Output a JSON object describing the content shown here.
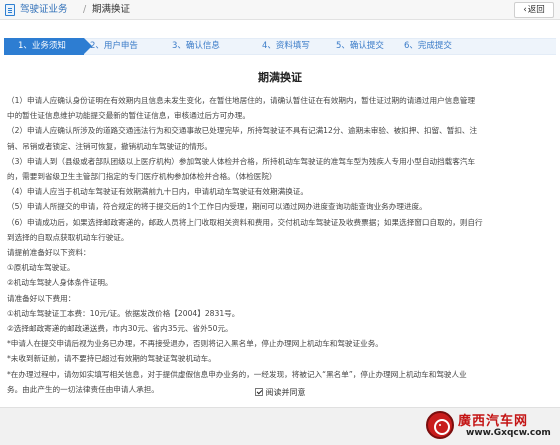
{
  "header": {
    "breadcrumb_link": "驾驶证业务",
    "breadcrumb_separator": "/",
    "breadcrumb_current": "期满换证",
    "back_button": "返回",
    "back_arrow": "‹"
  },
  "steps": [
    {
      "label": "1、业务须知",
      "active": true
    },
    {
      "label": "2、用户申告",
      "active": false
    },
    {
      "label": "3、确认信息",
      "active": false
    },
    {
      "label": "4、资料填写",
      "active": false
    },
    {
      "label": "5、确认提交",
      "active": false
    },
    {
      "label": "6、完成提交",
      "active": false
    }
  ],
  "page_title": "期满换证",
  "content_lines": [
    "（1）申请人应确认身份证明在有效期内且信息未发生变化，在暂住地居住的，请确认暂住证在有效期内，暂住证过期的请通过用户信息管理",
    "中的暂住证信息维护功能提交最新的暂住证信息，审核通过后方可办理。",
    "（2）申请人应确认所涉及的道路交通违法行为和交通事故已处理完毕，所持驾驶证不具有记满12分、逾期未审验、被扣押、扣留、暂扣、注",
    "销、吊销或者锁定、注销可恢复，撤销机动车驾驶证的情形。",
    "（3）申请人到（县级或者部队团级以上医疗机构）参加驾驶人体检并合格，所持机动车驾驶证的准驾车型为残疾人专用小型自动挡载客汽车",
    "的，需要到省级卫生主管部门指定的专门医疗机构参加体检并合格。（体检医院）",
    "（4）申请人应当于机动车驾驶证有效期满前九十日内，申请机动车驾驶证有效期满换证。",
    "（5）申请人所提交的申请，符合规定的将于提交后的1个工作日内受理，期间可以通过网办进度查询功能查询业务办理进度。",
    "（6）申请成功后，如果选择邮政寄递的，邮政人员将上门收取相关资料和费用，交付机动车驾驶证及收费票据；如果选择窗口自取的，则自行",
    "到选择的自取点获取机动车行驶证。",
    "请提前准备好以下资料：",
    "①原机动车驾驶证。",
    "②机动车驾驶人身体条件证明。",
    "请准备好以下费用：",
    "①机动车驾驶证工本费：10元/证。依据发改价格【2004】2831号。",
    "②选择邮政寄递的邮政递送费，市内30元、省内35元、省外50元。",
    "*申请人在提交申请后视为业务已办理，不再接受退办，否则将记入黑名单，停止办理网上机动车和驾驶证业务。",
    "*未收到新证前，请不要持已超过有效期的驾驶证驾驶机动车。",
    "*在办理过程中，请勿如实填写相关信息，对于提供虚假信息申办业务的，一经发现，将被记入“黑名单”，停止办理网上机动车和驾驶人业",
    "务。由此产生的一切法律责任由申请人承担。"
  ],
  "agree": {
    "label": "阅读并同意",
    "checked": true
  },
  "watermark": {
    "title": "廣西汽车网",
    "url": "www.Gxqcw.com"
  },
  "colors": {
    "accent": "#2d7dd2",
    "link": "#2f6fb8",
    "watermark_red": "#c41414"
  },
  "icons": {
    "doc": "document-icon",
    "check": "check-icon",
    "logo": "steering-wheel-logo"
  }
}
